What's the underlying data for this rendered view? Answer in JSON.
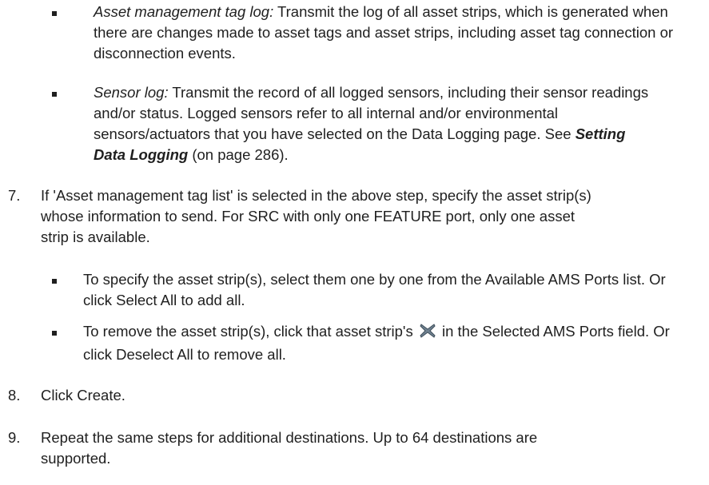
{
  "sublist_a": [
    {
      "term": "Asset management tag log:",
      "text": "Transmit the log of all asset strips, which is generated when there are changes made to asset tags and asset strips, including asset tag connection or disconnection events."
    },
    {
      "term": "Sensor log:",
      "text_before_link": "Transmit the record of all logged sensors, including their sensor readings and/or status. Logged sensors refer to all internal and/or environmental sensors/actuators that you have selected on the Data Logging page. See",
      "link": "Setting Data Logging",
      "text_after_link": "(on page 286)."
    }
  ],
  "steps": [
    {
      "number": "7.",
      "text": "If 'Asset management tag list' is selected in the above step, specify the asset strip(s) whose information to send. For SRC with only one FEATURE port, only one asset strip is available."
    },
    {
      "number": "8.",
      "text": "Click Create."
    },
    {
      "number": "9.",
      "text": "Repeat the same steps for additional destinations. Up to 64 destinations are supported."
    }
  ],
  "sublist_b": [
    {
      "text": "To specify the asset strip(s), select them one by one from the Available AMS Ports list. Or click Select All to add all."
    },
    {
      "text_before_icon": "To remove the asset strip(s), click that asset strip's",
      "icon": "close-x-icon",
      "text_after_icon": "in the Selected AMS Ports field. Or click Deselect All to remove all."
    }
  ]
}
